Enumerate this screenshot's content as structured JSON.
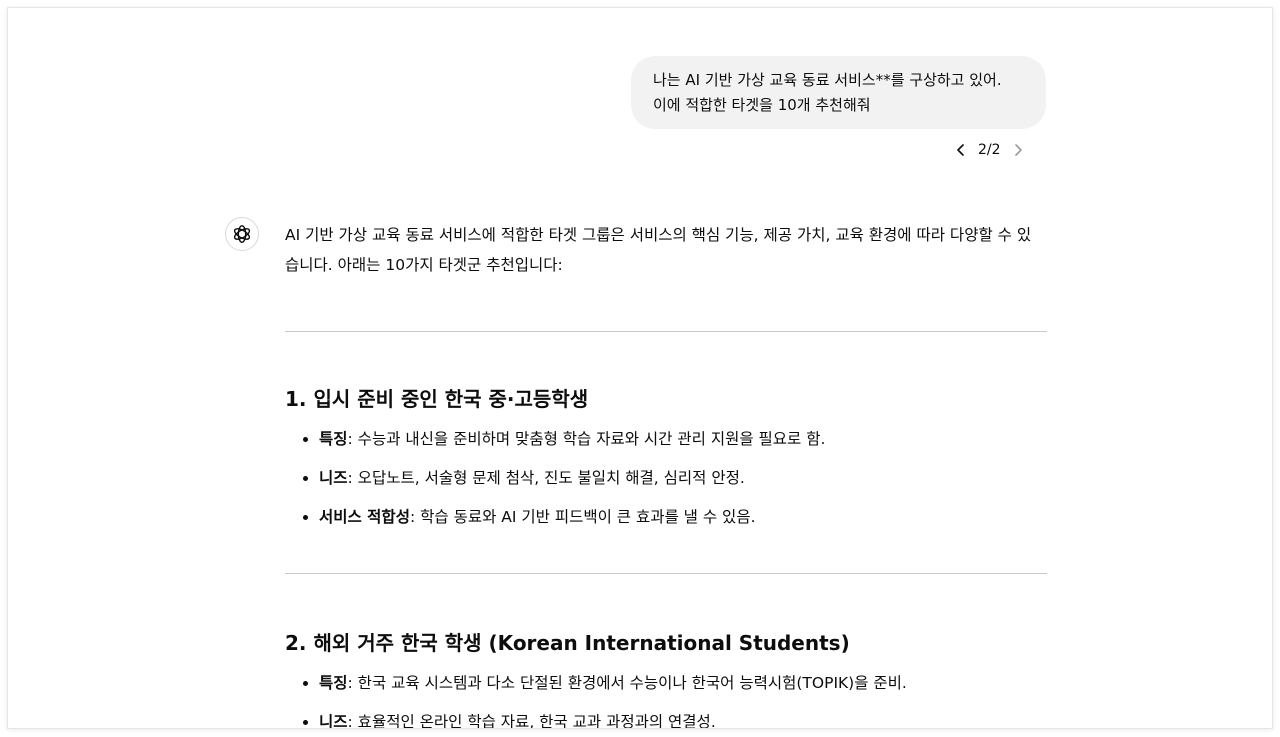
{
  "user_message": {
    "line1": "나는 AI 기반 가상 교육 동료 서비스**를 구상하고 있어.",
    "line2": "이에 적합한 타겟을 10개 추천해줘"
  },
  "pager": {
    "count": "2/2"
  },
  "response": {
    "intro_line1": "AI 기반 가상 교육 동료 서비스에 적합한 타겟 그룹은 서비스의 핵심 기능, 제공 가치, 교육 환경에 따라 다양할 수 있",
    "intro_line2": "습니다. 아래는 10가지 타겟군 추천입니다:",
    "sections": [
      {
        "title": "1. 입시 준비 중인 한국 중·고등학생",
        "items": [
          {
            "key": "특징",
            "text": ": 수능과 내신을 준비하며 맞춤형 학습 자료와 시간 관리 지원을 필요로 함."
          },
          {
            "key": "니즈",
            "text": ": 오답노트, 서술형 문제 첨삭, 진도 불일치 해결, 심리적 안정."
          },
          {
            "key": "서비스 적합성",
            "text": ": 학습 동료와 AI 기반 피드백이 큰 효과를 낼 수 있음."
          }
        ]
      },
      {
        "title": "2. 해외 거주 한국 학생 (Korean International Students)",
        "items": [
          {
            "key": "특징",
            "text": ": 한국 교육 시스템과 다소 단절된 환경에서 수능이나 한국어 능력시험(TOPIK)을 준비."
          },
          {
            "key": "니즈",
            "text": ": 효율적인 온라인 학습 자료, 한국 교과 과정과의 연결성."
          }
        ]
      }
    ]
  },
  "icons": {
    "avatar": "openai-logo-icon",
    "prev": "chevron-left-icon",
    "next": "chevron-right-icon"
  }
}
